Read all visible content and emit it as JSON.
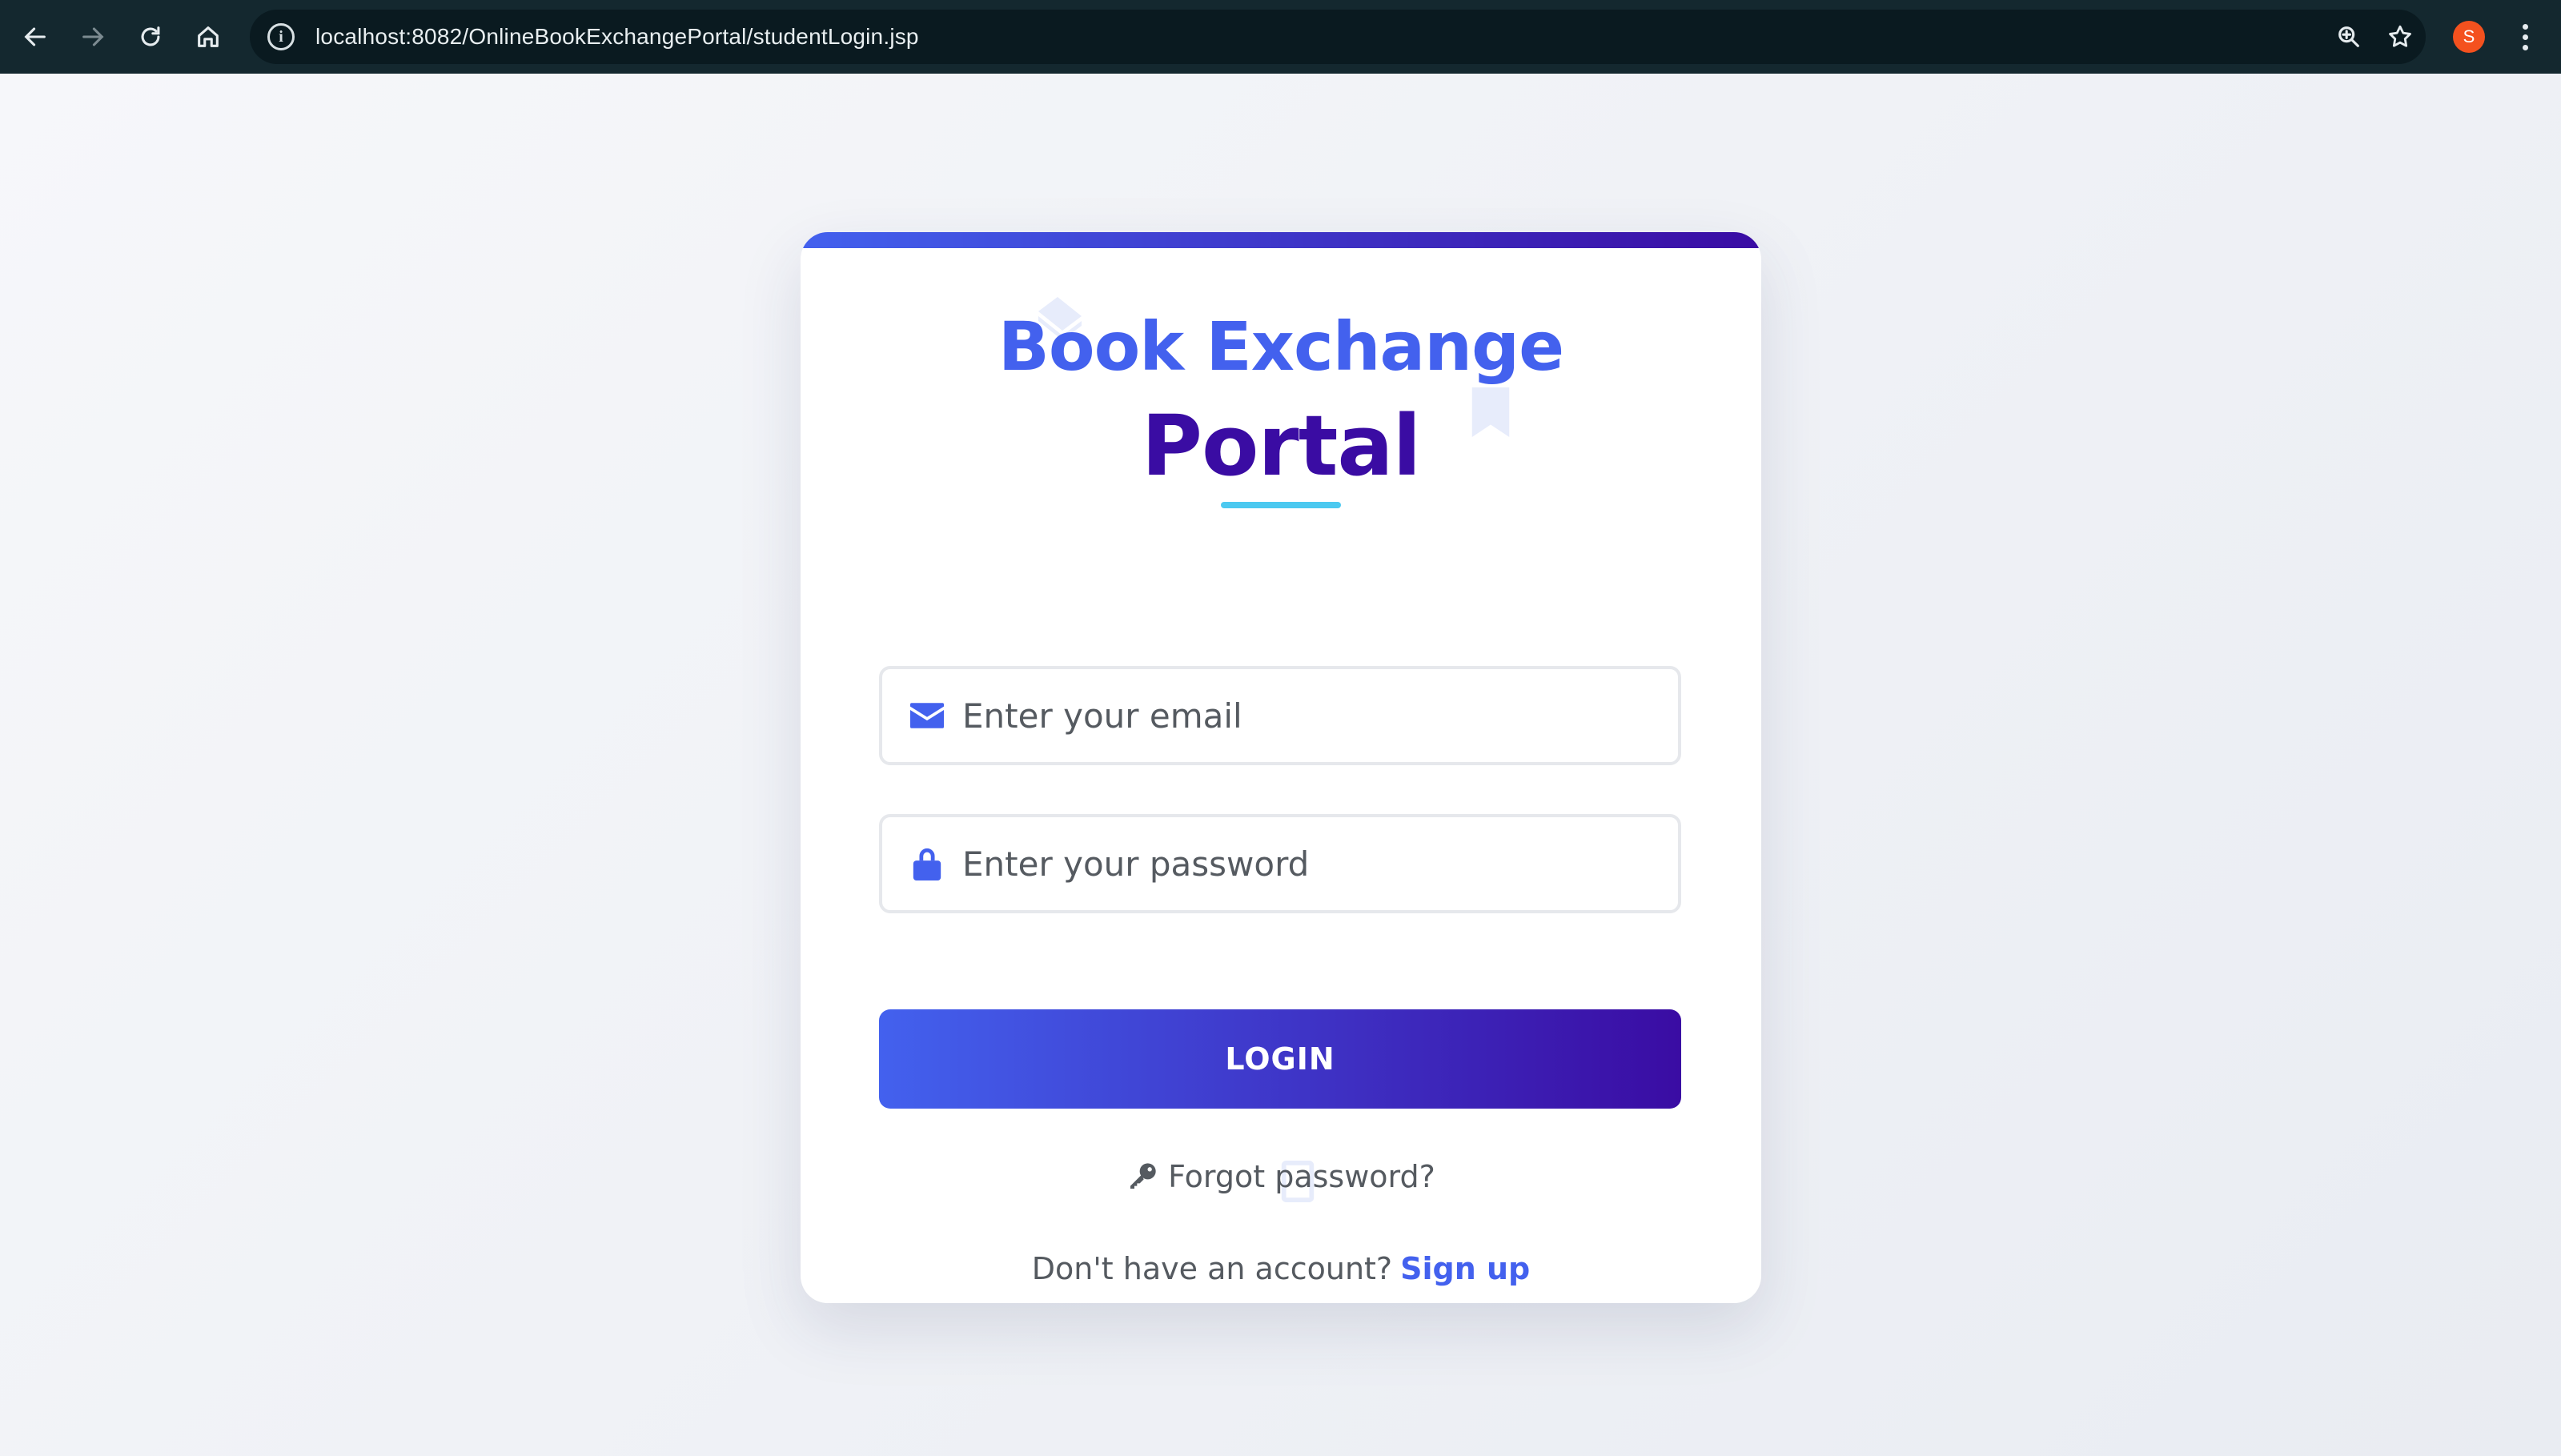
{
  "browser": {
    "url": "localhost:8082/OnlineBookExchangePortal/studentLogin.jsp",
    "profile_initial": "S",
    "icons": [
      "back-arrow-icon",
      "forward-arrow-icon",
      "reload-icon",
      "home-icon",
      "info-icon",
      "zoom-icon",
      "star-icon",
      "menu-dots-icon"
    ]
  },
  "card": {
    "title_line1": "Book Exchange",
    "title_line2": "Portal",
    "email": {
      "placeholder": "Enter your email",
      "value": "",
      "icon": "envelope-icon"
    },
    "password": {
      "placeholder": "Enter your password",
      "value": "",
      "icon": "lock-icon"
    },
    "login_label": "LOGIN",
    "forgot_label": "Forgot password?",
    "signup_prompt": "Don't have an account?",
    "signup_link": "Sign up"
  },
  "colors": {
    "primary": "#4361ee",
    "secondary": "#3a0ca3",
    "accent": "#4cc9f0",
    "browser_bar": "#14282f",
    "profile": "#f4511e"
  }
}
